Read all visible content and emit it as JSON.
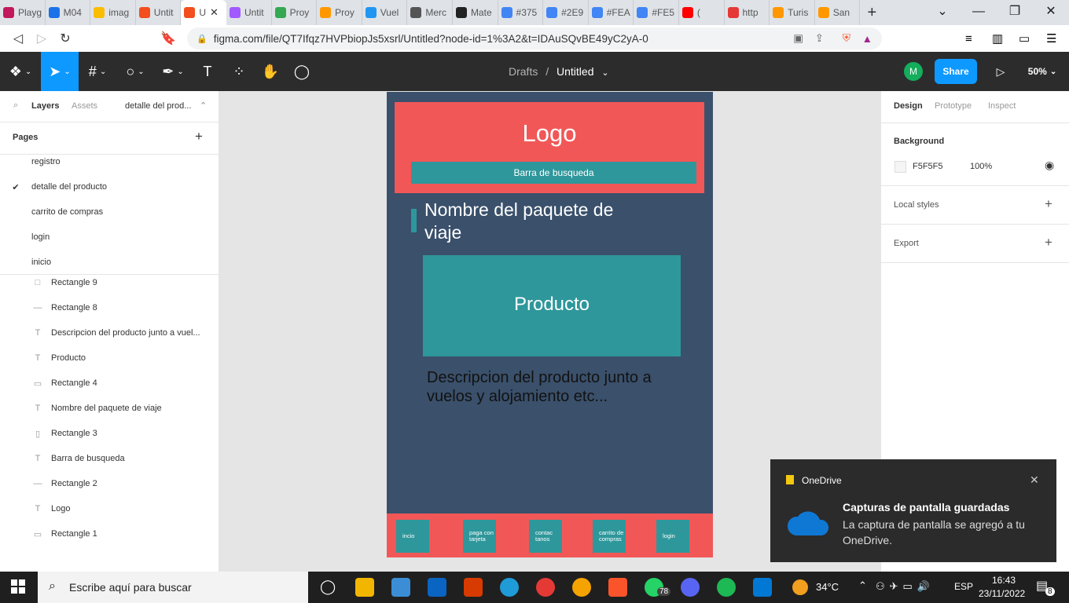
{
  "browser": {
    "tabs": [
      {
        "title": "Playg",
        "icon": "play-icon",
        "color": "#c2185b"
      },
      {
        "title": "M04",
        "icon": "google-drive-icon",
        "color": "#1a73e8"
      },
      {
        "title": "imag",
        "icon": "google-drive-icon",
        "color": "#fbbc04"
      },
      {
        "title": "Untit",
        "icon": "figma-icon",
        "color": "#f24e1e"
      },
      {
        "title": "U",
        "icon": "figma-icon",
        "color": "#f24e1e",
        "active": true
      },
      {
        "title": "Untit",
        "icon": "figma-icon",
        "color": "#a259ff"
      },
      {
        "title": "Proy",
        "icon": "google-drive-icon",
        "color": "#34a853"
      },
      {
        "title": "Proy",
        "icon": "trello-icon",
        "color": "#ff9800"
      },
      {
        "title": "Vuel",
        "icon": "telegram-icon",
        "color": "#2196f3"
      },
      {
        "title": "Merc",
        "icon": "globe-icon",
        "color": "#555555"
      },
      {
        "title": "Mate",
        "icon": "github-icon",
        "color": "#222222"
      },
      {
        "title": "#375",
        "icon": "google-icon",
        "color": "#4285f4"
      },
      {
        "title": "#2E9",
        "icon": "google-icon",
        "color": "#4285f4"
      },
      {
        "title": "#FEA",
        "icon": "google-icon",
        "color": "#4285f4"
      },
      {
        "title": "#FE5",
        "icon": "google-icon",
        "color": "#4285f4"
      },
      {
        "title": "(",
        "icon": "youtube-icon",
        "color": "#ff0000"
      },
      {
        "title": "http",
        "icon": "pin-icon",
        "color": "#e53935"
      },
      {
        "title": "Turis",
        "icon": "flag-icon",
        "color": "#ff9800"
      },
      {
        "title": "San",
        "icon": "flag-icon",
        "color": "#ff9800"
      }
    ],
    "new_tab": "+",
    "url": "figma.com/file/QT7Ifqz7HVPbiopJs5xsrl/Untitled?node-id=1%3A2&t=IDAuSQvBE49yC2yA-0"
  },
  "figma": {
    "breadcrumb_parent": "Drafts",
    "breadcrumb_sep": "/",
    "file_name": "Untitled",
    "avatar": "M",
    "share": "Share",
    "zoom": "50%",
    "left": {
      "tab_layers": "Layers",
      "tab_assets": "Assets",
      "current_page": "detalle del prod...",
      "pages_title": "Pages",
      "pages": [
        {
          "name": "registro",
          "active": false
        },
        {
          "name": "detalle del producto",
          "active": true
        },
        {
          "name": "carrito de compras",
          "active": false
        },
        {
          "name": "login",
          "active": false
        },
        {
          "name": "inicio",
          "active": false
        }
      ],
      "layers": [
        {
          "name": "Rectangle 9",
          "icon": "square-icon"
        },
        {
          "name": "Rectangle 8",
          "icon": "line-rect-icon"
        },
        {
          "name": "Descripcion del producto junto a vuel...",
          "icon": "text-icon"
        },
        {
          "name": "Producto",
          "icon": "text-icon"
        },
        {
          "name": "Rectangle 4",
          "icon": "rect-icon"
        },
        {
          "name": "Nombre del paquete de viaje",
          "icon": "text-icon"
        },
        {
          "name": "Rectangle 3",
          "icon": "vertical-rect-icon"
        },
        {
          "name": "Barra de busqueda",
          "icon": "text-icon"
        },
        {
          "name": "Rectangle 2",
          "icon": "line-rect-icon"
        },
        {
          "name": "Logo",
          "icon": "text-icon"
        },
        {
          "name": "Rectangle 1",
          "icon": "rect-icon"
        }
      ]
    },
    "right": {
      "tabs": [
        "Design",
        "Prototype",
        "Inspect"
      ],
      "background_label": "Background",
      "bg_hex": "F5F5F5",
      "bg_opacity": "100%",
      "local_styles": "Local styles",
      "export": "Export"
    },
    "canvas": {
      "logo": "Logo",
      "search_bar": "Barra de busqueda",
      "package_name": "Nombre del paquete de viaje",
      "product": "Producto",
      "description": "Descripcion del producto junto a vuelos y alojamiento etc...",
      "footer_buttons": [
        "incio",
        "paga con tarjeta",
        "contac tanos",
        "carrito de compras",
        "login"
      ]
    },
    "colors": {
      "frame": "#3a506b",
      "header": "#f25757",
      "teal": "#2e979b",
      "accent": "#0d99ff"
    }
  },
  "toast": {
    "app": "OneDrive",
    "title": "Capturas de pantalla guardadas",
    "body": "La captura de pantalla se agregó a tu OneDrive."
  },
  "taskbar": {
    "search_placeholder": "Escribe aquí para buscar",
    "weather": "34°C",
    "lang": "ESP",
    "time": "16:43",
    "date": "23/11/2022",
    "whatsapp_badge": "78",
    "notif_badge": "8"
  }
}
